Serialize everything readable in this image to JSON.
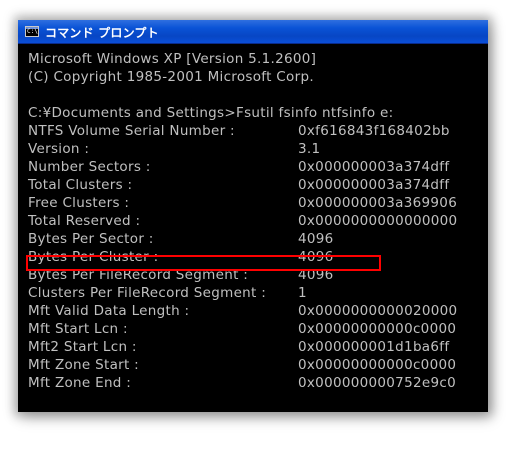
{
  "window": {
    "title": "コマンド プロンプト",
    "icon": "cmd-icon",
    "icon_glyph": "C:\\"
  },
  "console": {
    "header_lines": [
      "Microsoft Windows XP [Version 5.1.2600]",
      "(C) Copyright 1985-2001 Microsoft Corp."
    ],
    "command": "C:¥Documents and Settings>Fsutil fsinfo ntfsinfo e:",
    "rows": [
      {
        "label": "NTFS Volume Serial Number :",
        "value": "0xf616843f168402bb"
      },
      {
        "label": "Version :",
        "value": "3.1"
      },
      {
        "label": "Number Sectors :",
        "value": "0x000000003a374dff"
      },
      {
        "label": "Total Clusters :",
        "value": "0x000000003a374dff"
      },
      {
        "label": "Free Clusters  :",
        "value": "0x000000003a369906"
      },
      {
        "label": "Total Reserved :",
        "value": "0x0000000000000000"
      },
      {
        "label": "Bytes Per Sector  :",
        "value": "4096"
      },
      {
        "label": "Bytes Per Cluster :",
        "value": "4096"
      },
      {
        "label": "Bytes Per FileRecord Segment    :",
        "value": "4096"
      },
      {
        "label": "Clusters Per FileRecord Segment :",
        "value": "1"
      },
      {
        "label": "Mft Valid Data Length :",
        "value": "0x0000000000020000"
      },
      {
        "label": "Mft Start Lcn  :",
        "value": "0x00000000000c0000"
      },
      {
        "label": "Mft2 Start Lcn :",
        "value": "0x000000001d1ba6ff"
      },
      {
        "label": "Mft Zone Start :",
        "value": "0x00000000000c0000"
      },
      {
        "label": "Mft Zone End   :",
        "value": "0x000000000752e9c0"
      }
    ],
    "highlighted_row": "Bytes Per Sector",
    "colors": {
      "background": "#000000",
      "text": "#c0c0c0",
      "highlight_border": "#ff0000",
      "titlebar": "#0a53d6"
    }
  }
}
